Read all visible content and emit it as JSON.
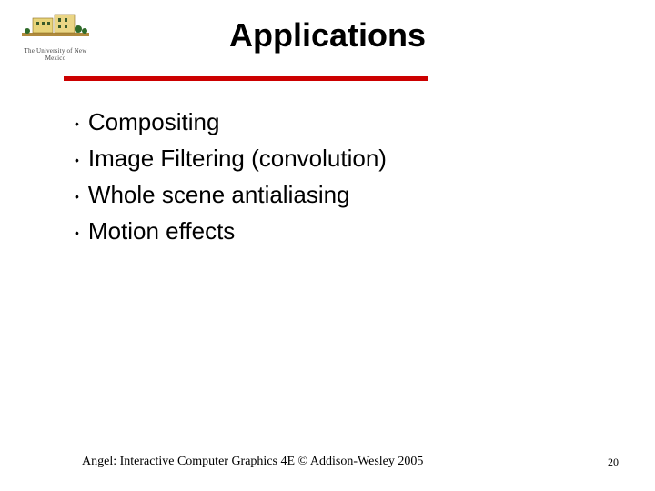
{
  "logo_caption": "The University of New Mexico",
  "title": "Applications",
  "bullets": [
    "Compositing",
    "Image Filtering (convolution)",
    "Whole scene antialiasing",
    "Motion effects"
  ],
  "footer_left": "Angel: Interactive Computer Graphics 4E © Addison-Wesley 2005",
  "page_number": "20",
  "colors": {
    "accent": "#cc0000"
  }
}
